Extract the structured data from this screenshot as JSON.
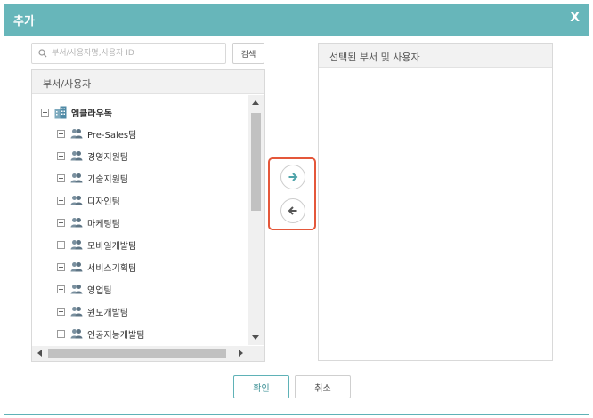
{
  "dialog": {
    "title": "추가",
    "close_label": "X"
  },
  "search": {
    "placeholder": "부서/사용자명,사용자 ID",
    "button_label": "검색"
  },
  "tree": {
    "header": "부서/사용자",
    "root": {
      "label": "엠클라우독",
      "icon": "building-icon",
      "expanded": true
    },
    "items": [
      {
        "label": "Pre-Sales팀",
        "icon": "group-icon"
      },
      {
        "label": "경영지원팀",
        "icon": "group-icon"
      },
      {
        "label": "기술지원팀",
        "icon": "group-icon"
      },
      {
        "label": "디자인팀",
        "icon": "group-icon"
      },
      {
        "label": "마케팅팀",
        "icon": "group-icon"
      },
      {
        "label": "모바일개발팀",
        "icon": "group-icon"
      },
      {
        "label": "서비스기획팀",
        "icon": "group-icon"
      },
      {
        "label": "영업팀",
        "icon": "group-icon"
      },
      {
        "label": "윈도개발팀",
        "icon": "group-icon"
      },
      {
        "label": "인공지능개발팀",
        "icon": "group-icon"
      }
    ]
  },
  "transfer": {
    "add_icon": "arrow-right-icon",
    "remove_icon": "arrow-left-icon"
  },
  "selected": {
    "header": "선택된 부서 및 사용자"
  },
  "footer": {
    "ok_label": "확인",
    "cancel_label": "취소"
  },
  "colors": {
    "titlebar": "#67b6ba",
    "accent": "#5fb2b7",
    "highlight": "#e4573a",
    "group_icon": "#6e8595"
  }
}
